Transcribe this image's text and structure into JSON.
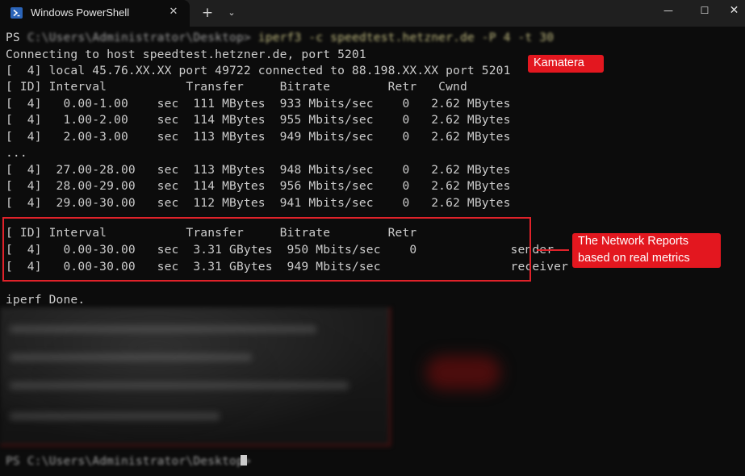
{
  "window": {
    "tab_title": "Windows PowerShell",
    "new_tab_glyph": "+",
    "dropdown_glyph": "⌄",
    "minimize_glyph": "—",
    "maximize_glyph": "☐",
    "close_glyph": "✕",
    "tab_close_glyph": "✕"
  },
  "terminal": {
    "prompt_prefix": "PS ",
    "prompt_path": "C:\\Users\\Administrator\\Desktop> ",
    "command": "iperf3 -c speedtest.hetzner.de -P 4 -t 30",
    "lines": [
      "Connecting to host speedtest.hetzner.de, port 5201",
      "[  4] local 45.76.XX.XX port 49722 connected to 88.198.XX.XX port 5201",
      "[ ID] Interval           Transfer     Bitrate        Retr   Cwnd",
      "[  4]   0.00-1.00    sec  111 MBytes  933 Mbits/sec    0   2.62 MBytes",
      "[  4]   1.00-2.00    sec  114 MBytes  955 Mbits/sec    0   2.62 MBytes",
      "[  4]   2.00-3.00    sec  113 MBytes  949 Mbits/sec    0   2.62 MBytes",
      "...",
      "[  4]  27.00-28.00   sec  113 MBytes  948 Mbits/sec    0   2.62 MBytes",
      "[  4]  28.00-29.00   sec  114 MBytes  956 Mbits/sec    0   2.62 MBytes",
      "[  4]  29.00-30.00   sec  112 MBytes  941 Mbits/sec    0   2.62 MBytes"
    ],
    "summary_lines": [
      "[ ID] Interval           Transfer     Bitrate        Retr",
      "[  4]   0.00-30.00   sec  3.31 GBytes  950 Mbits/sec    0             sender",
      "[  4]   0.00-30.00   sec  3.31 GBytes  949 Mbits/sec                  receiver"
    ],
    "done_line": "iperf Done.",
    "final_prompt": "PS C:\\Users\\Administrator\\Desktop> "
  },
  "annotations": {
    "kamatera_label": "Kamatera",
    "network_label_line1": "The Network Reports",
    "network_label_line2": "based on real metrics",
    "accent_color": "#e3171f"
  }
}
